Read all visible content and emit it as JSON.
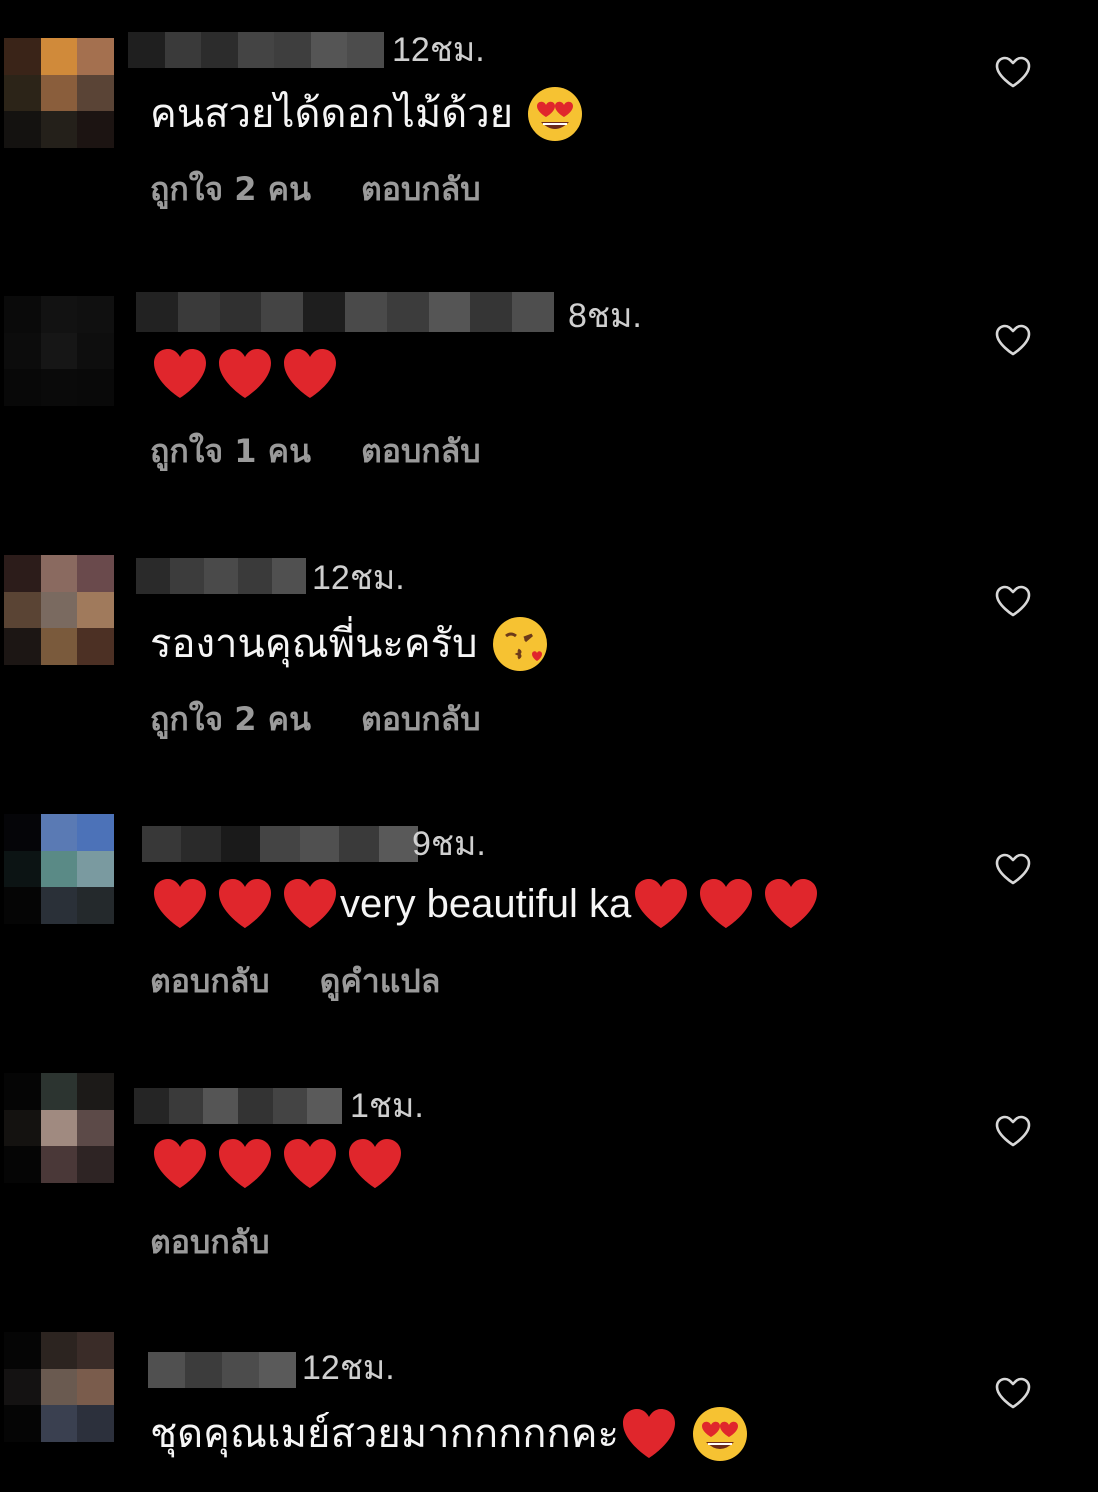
{
  "colors": {
    "background": "#000000",
    "text": "#f5f5f5",
    "meta": "#cfcfcf",
    "action": "#9a9a9a",
    "heart": "#e0262c"
  },
  "comments": [
    {
      "time": "12ชม.",
      "text_before": "คนสวยได้ดอกไม้ด้วย",
      "emoji_after": "smiling-face-heart-eyes",
      "likes": "ถูกใจ 2 คน",
      "reply": "ตอบกลับ"
    },
    {
      "time": "8ชม.",
      "hearts": 3,
      "likes": "ถูกใจ 1 คน",
      "reply": "ตอบกลับ"
    },
    {
      "time": "12ชม.",
      "text_before": "รองานคุณพี่นะครับ",
      "emoji_after": "face-blowing-kiss",
      "likes": "ถูกใจ 2 คน",
      "reply": "ตอบกลับ"
    },
    {
      "time": "9ชม.",
      "hearts_before": 3,
      "text_mid": "very beautiful ka",
      "hearts_after": 3,
      "reply": "ตอบกลับ",
      "translate": "ดูคำแปล"
    },
    {
      "time": "1ชม.",
      "hearts": 4,
      "reply": "ตอบกลับ"
    },
    {
      "time": "12ชม.",
      "text_before": "ชุดคุณเมย์สวยมากกกกกคะ",
      "emoji_after": "smiling-face-heart-eyes",
      "extra_heart": true
    }
  ],
  "icons": {
    "like": "heart-outline-icon"
  }
}
